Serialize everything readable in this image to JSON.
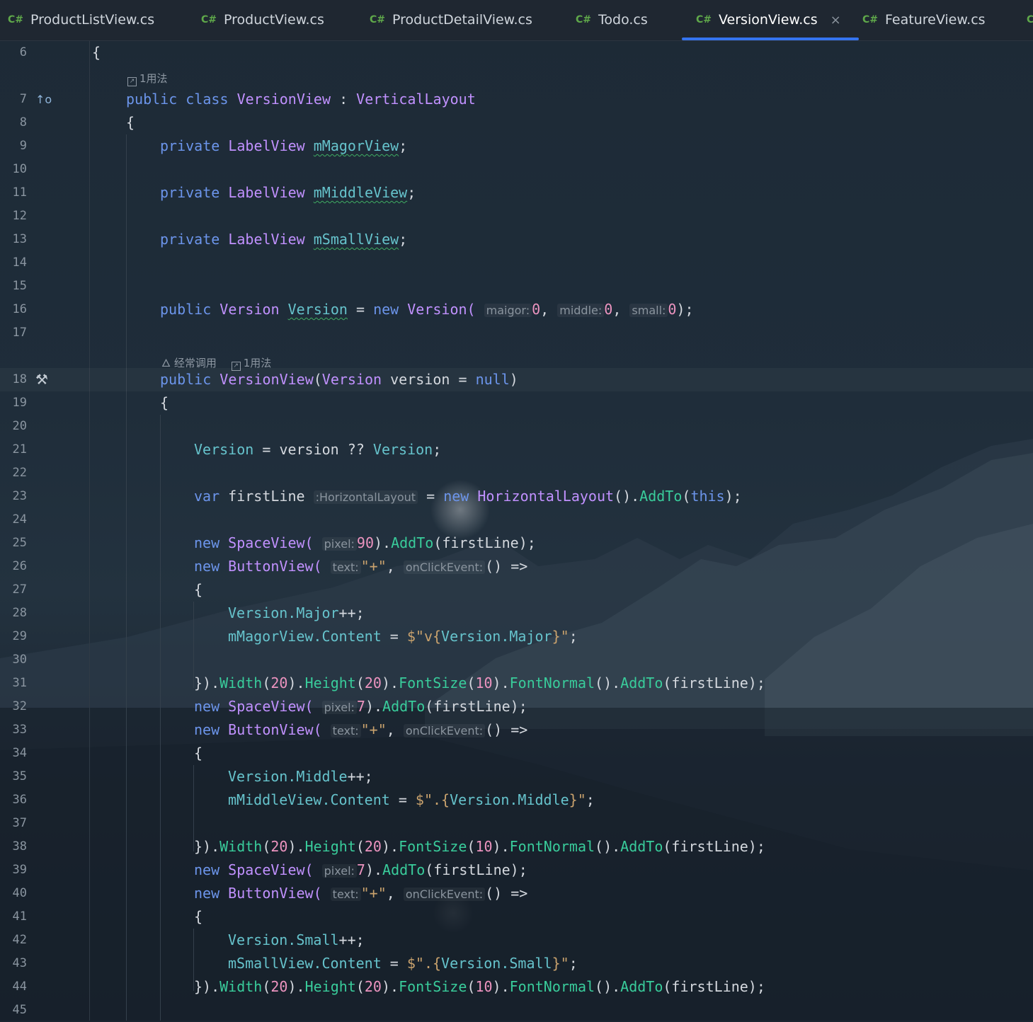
{
  "tabs": [
    {
      "lang": "C#",
      "name": "ProductListView.cs",
      "active": false
    },
    {
      "lang": "C#",
      "name": "ProductView.cs",
      "active": false
    },
    {
      "lang": "C#",
      "name": "ProductDetailView.cs",
      "active": false
    },
    {
      "lang": "C#",
      "name": "Todo.cs",
      "active": false
    },
    {
      "lang": "C#",
      "name": "VersionView.cs",
      "active": true
    },
    {
      "lang": "C#",
      "name": "FeatureView.cs",
      "active": false
    }
  ],
  "tab_close": "×",
  "hints": {
    "usage_1": "1用法",
    "frequent": "经常调用",
    "usage_2": "1用法"
  },
  "line_numbers": [
    "6",
    "7",
    "8",
    "9",
    "10",
    "11",
    "12",
    "13",
    "14",
    "15",
    "16",
    "17",
    "18",
    "19",
    "20",
    "21",
    "22",
    "23",
    "24",
    "25",
    "26",
    "27",
    "28",
    "29",
    "30",
    "31",
    "32",
    "33",
    "34",
    "35",
    "36",
    "37",
    "38",
    "39",
    "40",
    "41",
    "42",
    "43",
    "44",
    "45"
  ],
  "gutter_icons": {
    "line7": "implemented-icon",
    "line18": "hammer-icon"
  },
  "code": {
    "l6": [
      "{"
    ],
    "l7": [
      "public",
      "class",
      "VersionView",
      ":",
      "VerticalLayout"
    ],
    "l8": [
      "{"
    ],
    "l9": [
      "private",
      "LabelView",
      "mMagorView",
      ";"
    ],
    "l11": [
      "private",
      "LabelView",
      "mMiddleView",
      ";"
    ],
    "l13": [
      "private",
      "LabelView",
      "mSmallView",
      ";"
    ],
    "l16": [
      "public",
      "Version",
      "Version",
      "=",
      "new",
      "Version(",
      "maigor:",
      "0",
      ",",
      "middle:",
      "0",
      ",",
      "small:",
      "0",
      ");"
    ],
    "l18": [
      "public",
      "VersionView",
      "(",
      "Version",
      "version",
      "=",
      "null",
      ")"
    ],
    "l19": [
      "{"
    ],
    "l21": [
      "Version",
      "=",
      "version",
      "??",
      "Version",
      ";"
    ],
    "l23": [
      "var",
      "firstLine",
      ":HorizontalLayout",
      "=",
      "new",
      "HorizontalLayout",
      "().",
      "AddTo",
      "(",
      "this",
      ");"
    ],
    "l25": [
      "new",
      "SpaceView(",
      "pixel:",
      "90",
      ").",
      "AddTo",
      "(firstLine);"
    ],
    "l26": [
      "new",
      "ButtonView(",
      "text:",
      "\"+\"",
      ",",
      "onClickEvent:",
      "() =>"
    ],
    "l27": [
      "{"
    ],
    "l28": [
      "Version.",
      "Major",
      "++;"
    ],
    "l29": [
      "mMagorView.",
      "Content",
      " = ",
      "$\"v{",
      "Version.",
      "Major",
      "}\"",
      ";"
    ],
    "l31": [
      "}).",
      "Width",
      "(",
      "20",
      ").",
      "Height",
      "(",
      "20",
      ").",
      "FontSize",
      "(",
      "10",
      ").",
      "FontNormal",
      "().",
      "AddTo",
      "(firstLine);"
    ],
    "l32": [
      "new",
      "SpaceView(",
      "pixel:",
      "7",
      ").",
      "AddTo",
      "(firstLine);"
    ],
    "l33": [
      "new",
      "ButtonView(",
      "text:",
      "\"+\"",
      ",",
      "onClickEvent:",
      "() =>"
    ],
    "l34": [
      "{"
    ],
    "l35": [
      "Version.",
      "Middle",
      "++;"
    ],
    "l36": [
      "mMiddleView.",
      "Content",
      " = ",
      "$\".{",
      "Version.",
      "Middle",
      "}\"",
      ";"
    ],
    "l38": [
      "}).",
      "Width",
      "(",
      "20",
      ").",
      "Height",
      "(",
      "20",
      ").",
      "FontSize",
      "(",
      "10",
      ").",
      "FontNormal",
      "().",
      "AddTo",
      "(firstLine);"
    ],
    "l39": [
      "new",
      "SpaceView(",
      "pixel:",
      "7",
      ").",
      "AddTo",
      "(firstLine);"
    ],
    "l40": [
      "new",
      "ButtonView(",
      "text:",
      "\"+\"",
      ",",
      "onClickEvent:",
      "() =>"
    ],
    "l41": [
      "{"
    ],
    "l42": [
      "Version.",
      "Small",
      "++;"
    ],
    "l43": [
      "mSmallView.",
      "Content",
      " = ",
      "$\".{",
      "Version.",
      "Small",
      "}\"",
      ";"
    ],
    "l44": [
      "}).",
      "Width",
      "(",
      "20",
      ").",
      "Height",
      "(",
      "20",
      ").",
      "FontSize",
      "(",
      "10",
      ").",
      "FontNormal",
      "().",
      "AddTo",
      "(firstLine);"
    ]
  }
}
